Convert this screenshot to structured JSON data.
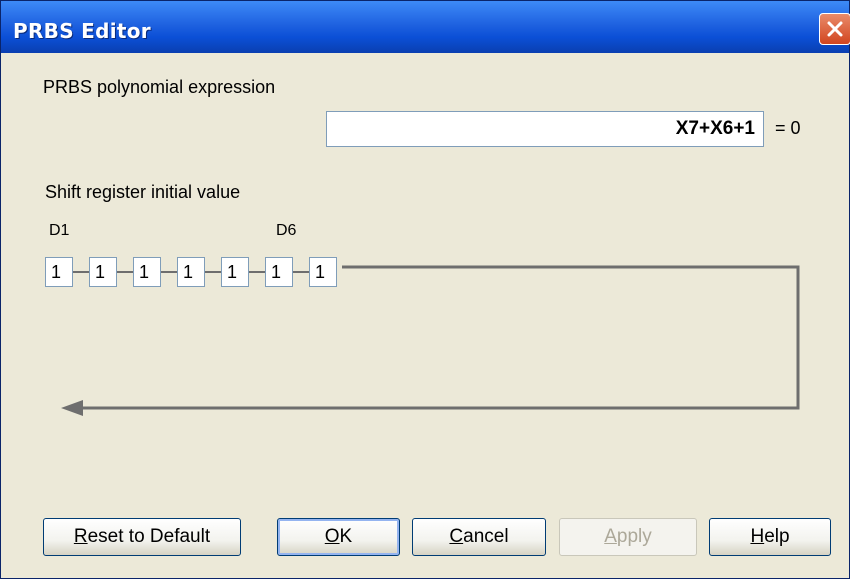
{
  "window": {
    "title": "PRBS Editor"
  },
  "polynomial": {
    "label": "PRBS polynomial expression",
    "value": "X7+X6+1",
    "equals": "= 0"
  },
  "shift_register": {
    "label": "Shift register initial value",
    "first_label": "D1",
    "marker_label": "D6",
    "cells": [
      "1",
      "1",
      "1",
      "1",
      "1",
      "1",
      "1"
    ]
  },
  "buttons": {
    "reset": {
      "prefix": "",
      "mnemonic": "R",
      "rest": "eset to Default"
    },
    "ok": {
      "prefix": "",
      "mnemonic": "O",
      "rest": "K"
    },
    "cancel": {
      "prefix": "",
      "mnemonic": "C",
      "rest": "ancel"
    },
    "apply": {
      "prefix": "",
      "mnemonic": "A",
      "rest": "pply",
      "enabled": false
    },
    "help": {
      "prefix": "",
      "mnemonic": "H",
      "rest": "elp"
    }
  },
  "colors": {
    "title_bar": "#0b4fd6",
    "close": "#d2451f",
    "dialog_bg": "#ece9d8",
    "line": "#6e6e6e"
  },
  "icons": {
    "close": "close-icon",
    "feedback_arrow": "arrow-left-icon"
  }
}
